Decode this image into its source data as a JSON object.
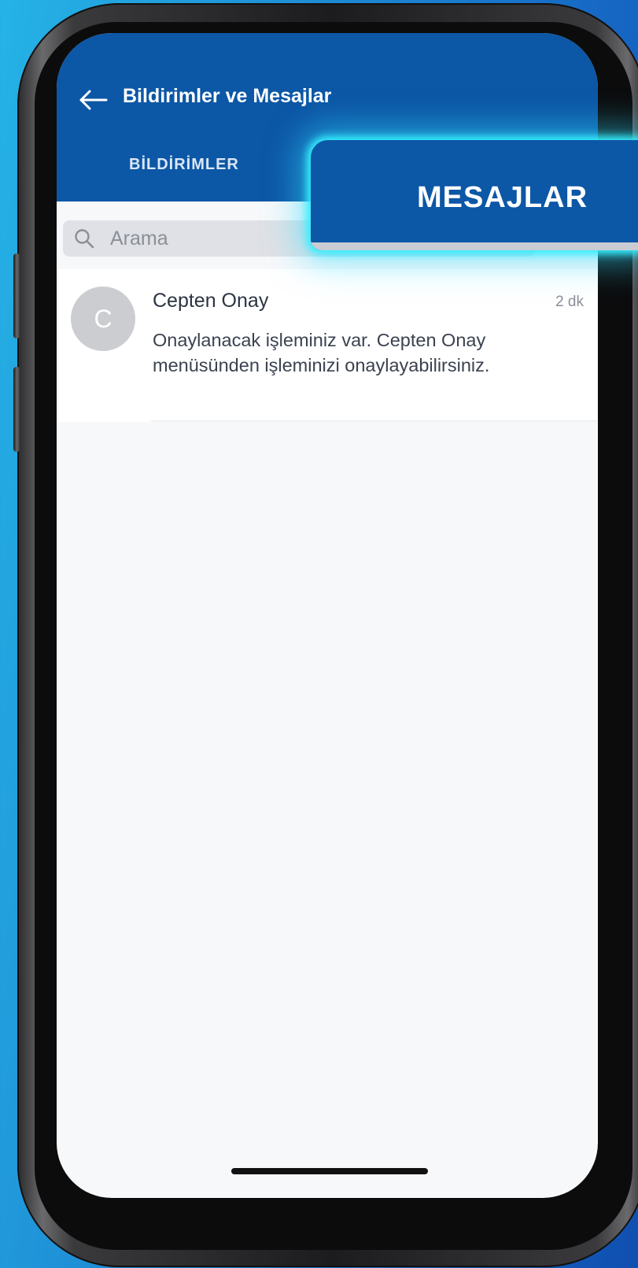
{
  "header": {
    "title": "Bildirimler ve Mesajlar",
    "back_icon": "arrow-left-icon"
  },
  "tabs": [
    {
      "label": "BİLDİRİMLER",
      "selected": false
    },
    {
      "label": "MESAJLAR",
      "selected": true
    }
  ],
  "search": {
    "placeholder": "Arama",
    "icon": "search-icon"
  },
  "messages": [
    {
      "avatar_initial": "C",
      "sender": "Cepten Onay",
      "time": "2 dk",
      "preview": "Onaylanacak işleminiz var. Cepten Onay menüsünden işleminizi onaylayabilirsiniz."
    }
  ],
  "colors": {
    "header_blue": "#0c57a6",
    "highlight_glow": "#35f0ff",
    "background": "#f7f8fa"
  }
}
